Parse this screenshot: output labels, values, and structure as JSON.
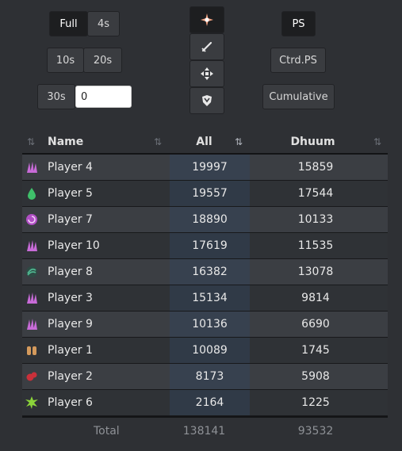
{
  "controls": {
    "phase_buttons": {
      "full": "Full",
      "s4": "4s",
      "s10": "10s",
      "s20": "20s",
      "s30": "30s"
    },
    "input_value": "0",
    "ps_button": "PS",
    "ctrd_button": "Ctrd.PS",
    "cumulative_button": "Cumulative",
    "mode_icons": [
      "star-burst-icon",
      "sword-icon",
      "move-arrows-icon",
      "shield-icon"
    ]
  },
  "table": {
    "columns": {
      "name": "Name",
      "all": "All",
      "dhuum": "Dhuum"
    },
    "rows": [
      {
        "name": "Player 4",
        "all": "19997",
        "dhuum": "15859",
        "icon": "claws-icon",
        "color": "#c86bd8"
      },
      {
        "name": "Player 5",
        "all": "19557",
        "dhuum": "17544",
        "icon": "droplet-icon",
        "color": "#3fbf6a"
      },
      {
        "name": "Player 7",
        "all": "18890",
        "dhuum": "10133",
        "icon": "spiral-icon",
        "color": "#b04fc4"
      },
      {
        "name": "Player 10",
        "all": "17619",
        "dhuum": "11535",
        "icon": "claws-icon",
        "color": "#c86bd8"
      },
      {
        "name": "Player 8",
        "all": "16382",
        "dhuum": "13078",
        "icon": "swirl-icon",
        "color": "#4fb48f"
      },
      {
        "name": "Player 3",
        "all": "15134",
        "dhuum": "9814",
        "icon": "claws-icon",
        "color": "#c86bd8"
      },
      {
        "name": "Player 9",
        "all": "10136",
        "dhuum": "6690",
        "icon": "claws-icon",
        "color": "#c86bd8"
      },
      {
        "name": "Player 1",
        "all": "10089",
        "dhuum": "1745",
        "icon": "fists-icon",
        "color": "#d49a5c"
      },
      {
        "name": "Player 2",
        "all": "8173",
        "dhuum": "5908",
        "icon": "gears-icon",
        "color": "#c9303a"
      },
      {
        "name": "Player 6",
        "all": "2164",
        "dhuum": "1225",
        "icon": "splat-icon",
        "color": "#8bd43a"
      }
    ],
    "total": {
      "label": "Total",
      "all": "138141",
      "dhuum": "93532"
    }
  }
}
